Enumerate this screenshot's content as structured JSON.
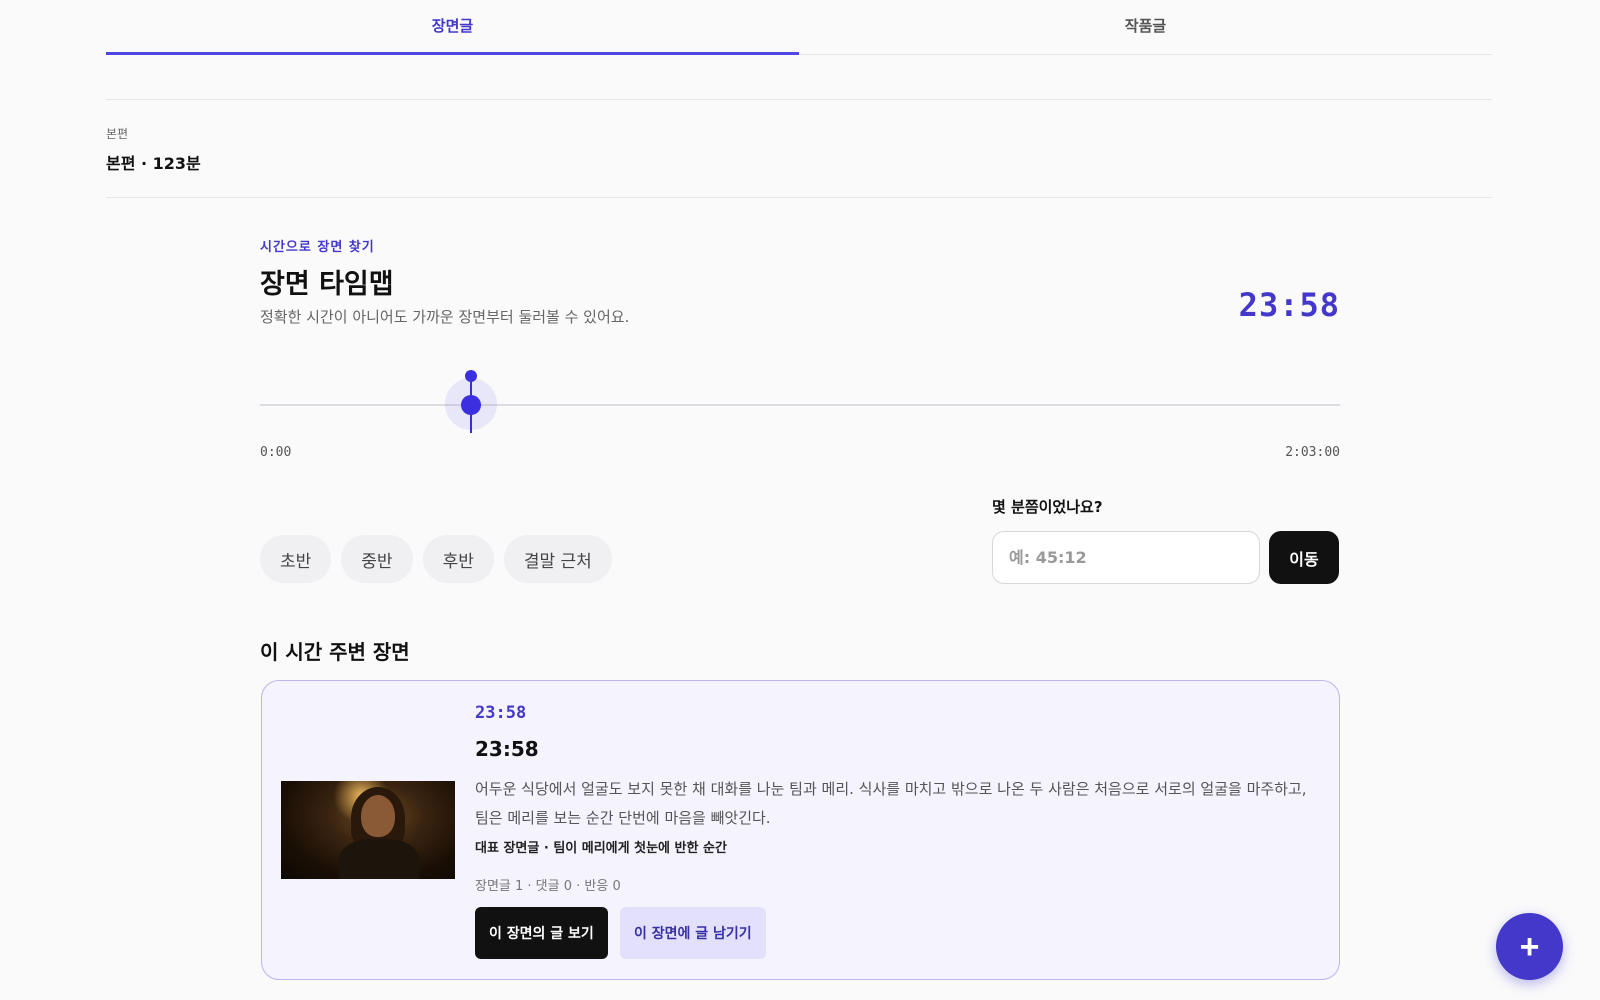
{
  "tabs": [
    {
      "label": "장면글",
      "active": true
    },
    {
      "label": "작품글",
      "active": false
    }
  ],
  "section": {
    "label": "본편",
    "value": "본편 · 123분"
  },
  "timemap": {
    "eyebrow": "시간으로 장면 찾기",
    "title": "장면 타임맵",
    "description": "정확한 시간이 아니어도 가까운 장면부터 둘러볼 수 있어요.",
    "current_time": "23:58",
    "start_label": "0:00",
    "end_label": "2:03:00",
    "position_fraction": 0.195
  },
  "quick_jump": {
    "chips": [
      "초반",
      "중반",
      "후반",
      "결말 근처"
    ],
    "label": "몇 분쯤이었나요?",
    "placeholder": "예: 45:12",
    "button": "이동"
  },
  "nearby": {
    "title": "이 시간 주변 장면",
    "scene": {
      "timestamp": "23:58",
      "title": "23:58",
      "description": "어두운 식당에서 얼굴도 보지 못한 채 대화를 나눈 팀과 메리. 식사를 마치고 밖으로 나온 두 사람은 처음으로 서로의 얼굴을 마주하고, 팀은 메리를 보는 순간 단번에 마음을 빼앗긴다.",
      "representative": "대표 장면글 · 팀이 메리에게 첫눈에 반한 순간",
      "stats": "장면글 1 · 댓글 0 · 반응 0",
      "view_button": "이 장면의 글 보기",
      "write_button": "이 장면에 글 남기기"
    }
  },
  "fab": {
    "icon": "plus-icon",
    "label": "+"
  },
  "colors": {
    "accent": "#4338ca",
    "dark_button": "#111111",
    "card_border": "#b9b6f2",
    "card_bg": "#f4f3fe"
  }
}
